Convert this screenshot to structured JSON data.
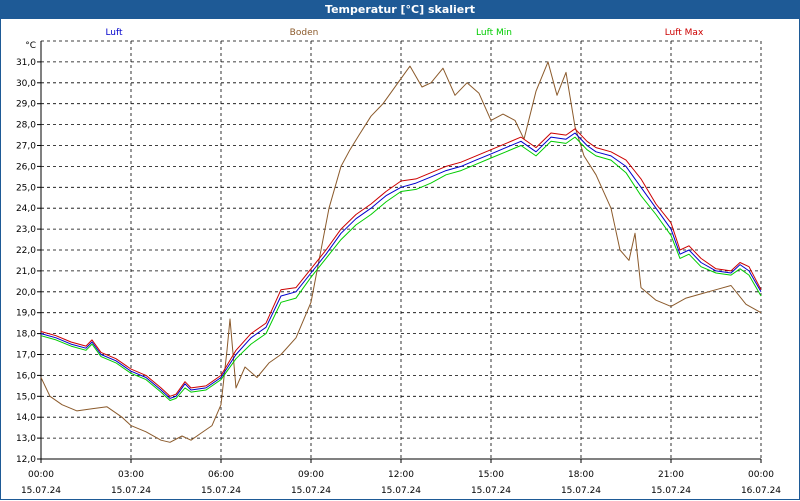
{
  "window": {
    "title": "Temperatur [°C] skaliert"
  },
  "chart_data": {
    "type": "line",
    "title": "Temperatur [°C] skaliert",
    "ylabel": "°C",
    "ylim": [
      12.0,
      32.0
    ],
    "xlim": [
      0,
      24
    ],
    "grid": true,
    "legend_position": "top",
    "y_ticks": [
      "12,0",
      "13,0",
      "14,0",
      "15,0",
      "16,0",
      "17,0",
      "18,0",
      "19,0",
      "20,0",
      "21,0",
      "22,0",
      "23,0",
      "24,0",
      "25,0",
      "26,0",
      "27,0",
      "28,0",
      "29,0",
      "30,0",
      "31,0"
    ],
    "x_tick_labels": [
      {
        "time": "00:00",
        "date": "15.07.24"
      },
      {
        "time": "03:00",
        "date": "15.07.24"
      },
      {
        "time": "06:00",
        "date": "15.07.24"
      },
      {
        "time": "09:00",
        "date": "15.07.24"
      },
      {
        "time": "12:00",
        "date": "15.07.24"
      },
      {
        "time": "15:00",
        "date": "15.07.24"
      },
      {
        "time": "18:00",
        "date": "15.07.24"
      },
      {
        "time": "21:00",
        "date": "15.07.24"
      },
      {
        "time": "00:00",
        "date": "16.07.24"
      }
    ],
    "series": [
      {
        "name": "Luft",
        "color": "#0000cc",
        "points": [
          [
            0,
            18.0
          ],
          [
            0.5,
            17.8
          ],
          [
            1,
            17.5
          ],
          [
            1.5,
            17.3
          ],
          [
            1.7,
            17.6
          ],
          [
            2,
            17.0
          ],
          [
            2.5,
            16.7
          ],
          [
            3,
            16.2
          ],
          [
            3.5,
            15.9
          ],
          [
            4,
            15.3
          ],
          [
            4.3,
            14.9
          ],
          [
            4.5,
            15.0
          ],
          [
            4.8,
            15.6
          ],
          [
            5,
            15.3
          ],
          [
            5.5,
            15.4
          ],
          [
            6,
            15.9
          ],
          [
            6.5,
            17.0
          ],
          [
            7,
            17.8
          ],
          [
            7.5,
            18.3
          ],
          [
            8,
            19.8
          ],
          [
            8.5,
            20.0
          ],
          [
            9,
            20.9
          ],
          [
            9.5,
            21.8
          ],
          [
            10,
            22.8
          ],
          [
            10.5,
            23.5
          ],
          [
            11,
            24.0
          ],
          [
            11.5,
            24.6
          ],
          [
            12,
            25.0
          ],
          [
            12.5,
            25.2
          ],
          [
            13,
            25.5
          ],
          [
            13.5,
            25.8
          ],
          [
            14,
            26.0
          ],
          [
            14.5,
            26.3
          ],
          [
            15,
            26.6
          ],
          [
            15.5,
            26.9
          ],
          [
            16,
            27.2
          ],
          [
            16.5,
            26.7
          ],
          [
            17,
            27.4
          ],
          [
            17.5,
            27.3
          ],
          [
            17.8,
            27.6
          ],
          [
            18.2,
            27.0
          ],
          [
            18.5,
            26.7
          ],
          [
            19,
            26.5
          ],
          [
            19.5,
            26.0
          ],
          [
            20,
            25.0
          ],
          [
            20.5,
            24.0
          ],
          [
            21,
            23.0
          ],
          [
            21.3,
            21.8
          ],
          [
            21.6,
            22.0
          ],
          [
            22,
            21.4
          ],
          [
            22.5,
            21.0
          ],
          [
            23,
            20.9
          ],
          [
            23.3,
            21.3
          ],
          [
            23.6,
            21.0
          ],
          [
            24,
            20.0
          ]
        ]
      },
      {
        "name": "Boden",
        "color": "#8b5a2b",
        "points": [
          [
            0,
            15.9
          ],
          [
            0.3,
            15.0
          ],
          [
            0.7,
            14.6
          ],
          [
            1.2,
            14.3
          ],
          [
            1.7,
            14.4
          ],
          [
            2.2,
            14.5
          ],
          [
            2.7,
            14.0
          ],
          [
            3,
            13.6
          ],
          [
            3.5,
            13.3
          ],
          [
            4,
            12.9
          ],
          [
            4.3,
            12.8
          ],
          [
            4.7,
            13.1
          ],
          [
            5,
            12.9
          ],
          [
            5.3,
            13.2
          ],
          [
            5.7,
            13.6
          ],
          [
            6,
            14.6
          ],
          [
            6.2,
            17.2
          ],
          [
            6.3,
            18.7
          ],
          [
            6.5,
            15.4
          ],
          [
            6.8,
            16.4
          ],
          [
            7.2,
            15.9
          ],
          [
            7.6,
            16.6
          ],
          [
            8,
            17.0
          ],
          [
            8.5,
            17.8
          ],
          [
            9,
            19.5
          ],
          [
            9.2,
            21.0
          ],
          [
            9.6,
            24.0
          ],
          [
            10,
            26.0
          ],
          [
            10.3,
            26.8
          ],
          [
            10.6,
            27.5
          ],
          [
            11,
            28.4
          ],
          [
            11.4,
            29.0
          ],
          [
            12,
            30.2
          ],
          [
            12.3,
            30.8
          ],
          [
            12.7,
            29.8
          ],
          [
            13,
            30.0
          ],
          [
            13.4,
            30.7
          ],
          [
            13.8,
            29.4
          ],
          [
            14.2,
            30.0
          ],
          [
            14.6,
            29.5
          ],
          [
            15,
            28.2
          ],
          [
            15.4,
            28.5
          ],
          [
            15.8,
            28.2
          ],
          [
            16.1,
            27.3
          ],
          [
            16.5,
            29.6
          ],
          [
            16.9,
            31.0
          ],
          [
            17.2,
            29.4
          ],
          [
            17.5,
            30.5
          ],
          [
            17.8,
            27.9
          ],
          [
            18.1,
            26.5
          ],
          [
            18.5,
            25.6
          ],
          [
            19,
            24.0
          ],
          [
            19.3,
            22.0
          ],
          [
            19.6,
            21.5
          ],
          [
            19.8,
            22.8
          ],
          [
            20,
            20.2
          ],
          [
            20.5,
            19.6
          ],
          [
            21,
            19.3
          ],
          [
            21.5,
            19.7
          ],
          [
            22,
            19.9
          ],
          [
            22.5,
            20.1
          ],
          [
            23,
            20.3
          ],
          [
            23.5,
            19.4
          ],
          [
            24,
            19.0
          ]
        ]
      },
      {
        "name": "Luft Min",
        "color": "#00cc00",
        "points": [
          [
            0,
            17.9
          ],
          [
            0.5,
            17.7
          ],
          [
            1,
            17.4
          ],
          [
            1.5,
            17.2
          ],
          [
            1.7,
            17.5
          ],
          [
            2,
            16.9
          ],
          [
            2.5,
            16.6
          ],
          [
            3,
            16.1
          ],
          [
            3.5,
            15.8
          ],
          [
            4,
            15.2
          ],
          [
            4.3,
            14.8
          ],
          [
            4.5,
            14.9
          ],
          [
            4.8,
            15.4
          ],
          [
            5,
            15.2
          ],
          [
            5.5,
            15.3
          ],
          [
            6,
            15.8
          ],
          [
            6.5,
            16.8
          ],
          [
            7,
            17.5
          ],
          [
            7.5,
            18.0
          ],
          [
            8,
            19.5
          ],
          [
            8.5,
            19.7
          ],
          [
            9,
            20.7
          ],
          [
            9.5,
            21.6
          ],
          [
            10,
            22.5
          ],
          [
            10.5,
            23.2
          ],
          [
            11,
            23.7
          ],
          [
            11.5,
            24.3
          ],
          [
            12,
            24.8
          ],
          [
            12.5,
            24.9
          ],
          [
            13,
            25.2
          ],
          [
            13.5,
            25.6
          ],
          [
            14,
            25.8
          ],
          [
            14.5,
            26.1
          ],
          [
            15,
            26.4
          ],
          [
            15.5,
            26.7
          ],
          [
            16,
            27.0
          ],
          [
            16.5,
            26.5
          ],
          [
            17,
            27.2
          ],
          [
            17.5,
            27.1
          ],
          [
            17.8,
            27.4
          ],
          [
            18.2,
            26.8
          ],
          [
            18.5,
            26.5
          ],
          [
            19,
            26.3
          ],
          [
            19.5,
            25.7
          ],
          [
            20,
            24.6
          ],
          [
            20.5,
            23.7
          ],
          [
            21,
            22.7
          ],
          [
            21.3,
            21.6
          ],
          [
            21.6,
            21.8
          ],
          [
            22,
            21.2
          ],
          [
            22.5,
            20.9
          ],
          [
            23,
            20.8
          ],
          [
            23.3,
            21.1
          ],
          [
            23.6,
            20.8
          ],
          [
            24,
            19.8
          ]
        ]
      },
      {
        "name": "Luft Max",
        "color": "#cc0000",
        "points": [
          [
            0,
            18.1
          ],
          [
            0.5,
            17.9
          ],
          [
            1,
            17.6
          ],
          [
            1.5,
            17.4
          ],
          [
            1.7,
            17.7
          ],
          [
            2,
            17.1
          ],
          [
            2.5,
            16.8
          ],
          [
            3,
            16.3
          ],
          [
            3.5,
            16.0
          ],
          [
            4,
            15.4
          ],
          [
            4.3,
            15.0
          ],
          [
            4.5,
            15.1
          ],
          [
            4.8,
            15.7
          ],
          [
            5,
            15.4
          ],
          [
            5.5,
            15.5
          ],
          [
            6,
            16.0
          ],
          [
            6.5,
            17.2
          ],
          [
            7,
            18.0
          ],
          [
            7.5,
            18.5
          ],
          [
            8,
            20.1
          ],
          [
            8.5,
            20.2
          ],
          [
            9,
            21.1
          ],
          [
            9.5,
            22.0
          ],
          [
            10,
            23.0
          ],
          [
            10.5,
            23.7
          ],
          [
            11,
            24.2
          ],
          [
            11.5,
            24.8
          ],
          [
            12,
            25.3
          ],
          [
            12.5,
            25.4
          ],
          [
            13,
            25.7
          ],
          [
            13.5,
            26.0
          ],
          [
            14,
            26.2
          ],
          [
            14.5,
            26.5
          ],
          [
            15,
            26.8
          ],
          [
            15.5,
            27.1
          ],
          [
            16,
            27.4
          ],
          [
            16.5,
            26.9
          ],
          [
            17,
            27.6
          ],
          [
            17.5,
            27.5
          ],
          [
            17.8,
            27.8
          ],
          [
            18.2,
            27.2
          ],
          [
            18.5,
            26.9
          ],
          [
            19,
            26.7
          ],
          [
            19.5,
            26.3
          ],
          [
            20,
            25.4
          ],
          [
            20.5,
            24.2
          ],
          [
            21,
            23.3
          ],
          [
            21.3,
            22.0
          ],
          [
            21.6,
            22.2
          ],
          [
            22,
            21.6
          ],
          [
            22.5,
            21.1
          ],
          [
            23,
            21.0
          ],
          [
            23.3,
            21.4
          ],
          [
            23.6,
            21.2
          ],
          [
            24,
            20.1
          ]
        ]
      }
    ]
  }
}
